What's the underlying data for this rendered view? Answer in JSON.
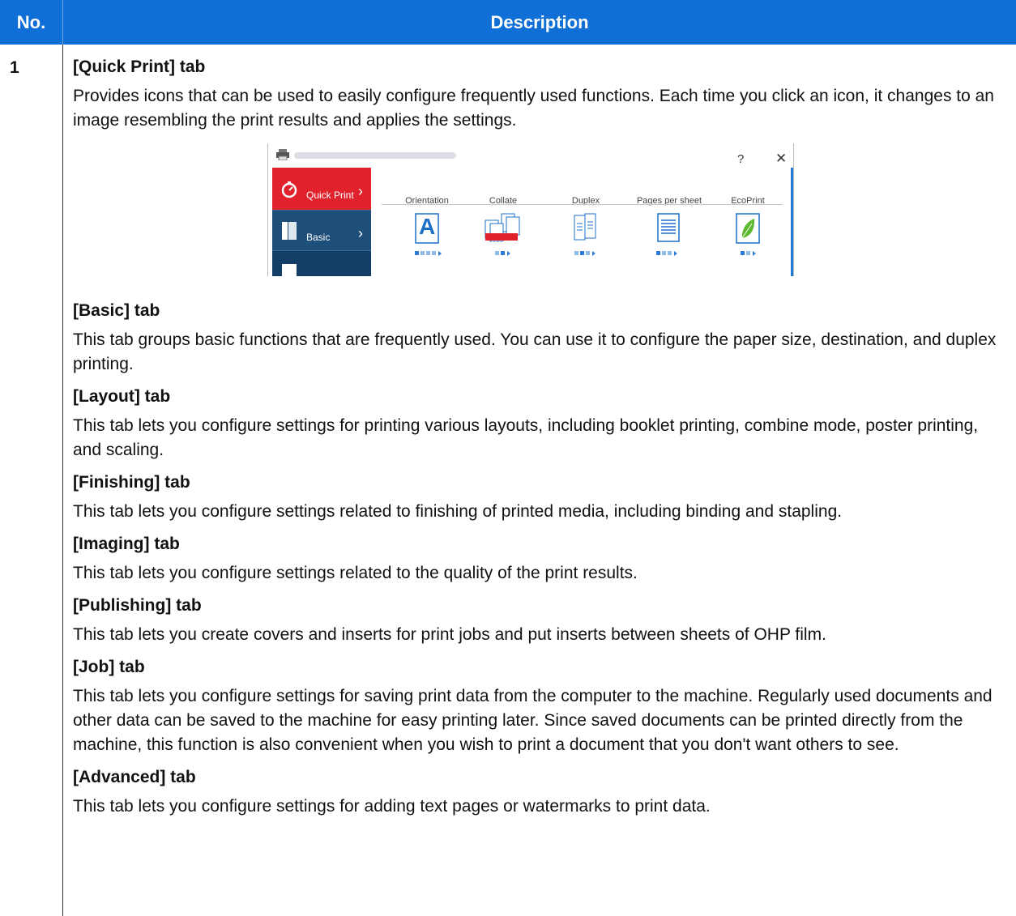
{
  "table": {
    "header_no": "No.",
    "header_description": "Description",
    "row_number": "1"
  },
  "screenshot": {
    "help_button": "?",
    "close_button": "✕",
    "sidebar": [
      {
        "label": "Quick Print",
        "icon": "stopwatch-icon",
        "active": true,
        "accent": "#e1212b"
      },
      {
        "label": "Basic",
        "icon": "document-icon",
        "active": false
      }
    ],
    "columns": [
      "Orientation",
      "Collate",
      "Duplex",
      "Pages per sheet",
      "EcoPrint"
    ],
    "collate_numbers": "123123",
    "orientation_letter": "A"
  },
  "sections": [
    {
      "title": "[Quick Print] tab",
      "body": "Provides icons that can be used to easily configure frequently used functions. Each time you click an icon, it changes to an image resembling the print results and applies the settings."
    },
    {
      "title": "[Basic] tab",
      "body": "This tab groups basic functions that are frequently used. You can use it to configure the paper size, destination, and duplex printing."
    },
    {
      "title": "[Layout] tab",
      "body": "This tab lets you configure settings for printing various layouts, including booklet printing, combine mode, poster printing, and scaling."
    },
    {
      "title": "[Finishing] tab",
      "body": "This tab lets you configure settings related to finishing of printed media, including binding and stapling."
    },
    {
      "title": "[Imaging] tab",
      "body": "This tab lets you configure settings related to the quality of the print results."
    },
    {
      "title": "[Publishing] tab",
      "body": "This tab lets you create covers and inserts for print jobs and put inserts between sheets of OHP film."
    },
    {
      "title": "[Job] tab",
      "body": "This tab lets you configure settings for saving print data from the computer to the machine. Regularly used documents and other data can be saved to the machine for easy printing later. Since saved documents can be printed directly from the machine, this function is also convenient when you wish to print a document that you don't want others to see."
    },
    {
      "title": "[Advanced] tab",
      "body": "This tab lets you configure settings for adding text pages or watermarks to print data."
    }
  ],
  "colors": {
    "header": "#0f6fd7",
    "accent_red": "#e1212b",
    "sidebar_blue": "#1d4f7e"
  }
}
